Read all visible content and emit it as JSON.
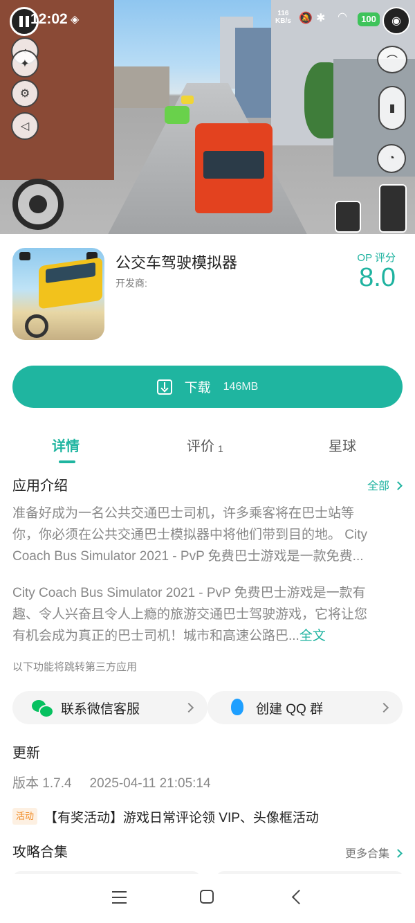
{
  "status_bar": {
    "time": "12:02",
    "speed_value": "116",
    "speed_unit": "KB/s",
    "battery": "100"
  },
  "app": {
    "title": "公交车驾驶模拟器",
    "developer_label": "开发商:",
    "op_label": "OP 评分",
    "op_score": "8.0"
  },
  "download": {
    "label": "下载",
    "size": "146MB"
  },
  "tabs": [
    {
      "label": "详情",
      "active": true
    },
    {
      "label": "评价",
      "count": "1"
    },
    {
      "label": "星球"
    }
  ],
  "intro": {
    "title": "应用介绍",
    "all_label": "全部",
    "para1_lines": [
      "准备好成为一名公共交通巴士司机，许多乘客将在巴士站等",
      "你，你必须在公共交通巴士模拟器中将他们带到目的地。 City",
      "Coach Bus Simulator 2021 - PvP 免费巴士游戏是一款免费..."
    ],
    "para2_lines": [
      "City Coach Bus Simulator 2021 - PvP 免费巴士游戏是一款有",
      "趣、令人兴奋且令人上瘾的旅游交通巴士驾驶游戏，它将让您",
      "有机会成为真正的巴士司机！城市和高速公路巴..."
    ],
    "full_text_link": "全文",
    "third_party_note": "以下功能将跳转第三方应用"
  },
  "actions": {
    "wechat_label": "联系微信客服",
    "qq_label": "创建 QQ 群"
  },
  "update": {
    "title": "更新",
    "version": "版本 1.7.4",
    "date": "2025-04-11 21:05:14"
  },
  "activity": {
    "badge": "活动",
    "text": "【有奖活动】游戏日常评论领 VIP、头像框活动"
  },
  "guides": {
    "title": "攻略合集",
    "more_label": "更多合集"
  },
  "colors": {
    "accent": "#1fb5a0",
    "activity_badge": "#f08a24"
  }
}
